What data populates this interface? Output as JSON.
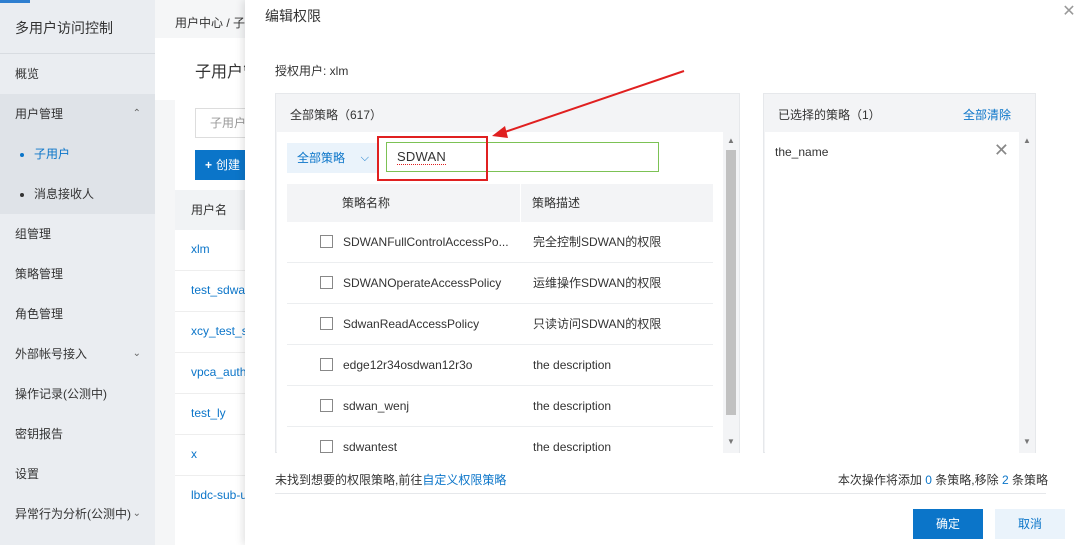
{
  "sidebar": {
    "title": "多用户访问控制",
    "items": [
      {
        "label": "概览"
      },
      {
        "label": "用户管理"
      },
      {
        "label": "子用户"
      },
      {
        "label": "消息接收人"
      },
      {
        "label": "组管理"
      },
      {
        "label": "策略管理"
      },
      {
        "label": "角色管理"
      },
      {
        "label": "外部帐号接入"
      },
      {
        "label": "操作记录(公测中)"
      },
      {
        "label": "密钥报告"
      },
      {
        "label": "设置"
      },
      {
        "label": "异常行为分析(公测中)"
      }
    ]
  },
  "background": {
    "breadcrumb": "用户中心 / 子",
    "page_title": "子用户管理",
    "search_placeholder": "子用户",
    "create_label": "创建",
    "col_username": "用户名",
    "rows": [
      "xlm",
      "test_sdwan",
      "xcy_test_s",
      "vpca_auth",
      "test_ly",
      "x",
      "lbdc-sub-u"
    ]
  },
  "modal": {
    "title": "编辑权限",
    "grant_user": "授权用户: xlm",
    "left_header": "全部策略（617）",
    "filter_label": "全部策略",
    "search_value": "SDWAN",
    "col_name": "策略名称",
    "col_desc": "策略描述",
    "policies": [
      {
        "name": "SDWANFullControlAccessPo...",
        "desc": "完全控制SDWAN的权限"
      },
      {
        "name": "SDWANOperateAccessPolicy",
        "desc": "运维操作SDWAN的权限"
      },
      {
        "name": "SdwanReadAccessPolicy",
        "desc": "只读访问SDWAN的权限"
      },
      {
        "name": "edge12r34osdwan12r3o",
        "desc": "the description"
      },
      {
        "name": "sdwan_wenj",
        "desc": "the description"
      },
      {
        "name": "sdwantest",
        "desc": "the description"
      }
    ],
    "right_header": "已选择的策略（1）",
    "clear_all": "全部清除",
    "selected": [
      "the_name"
    ],
    "footer_left_text": "未找到想要的权限策略,前往",
    "footer_left_link": "自定义权限策略",
    "footer_right": {
      "prefix": "本次操作将添加 ",
      "add": "0",
      "mid": " 条策略,移除 ",
      "remove": "2",
      "suffix": " 条策略"
    },
    "ok_label": "确定",
    "cancel_label": "取消"
  },
  "colors": {
    "accent": "#0b75c9",
    "annotation": "#e02020",
    "input_focus": "#7cc255"
  }
}
